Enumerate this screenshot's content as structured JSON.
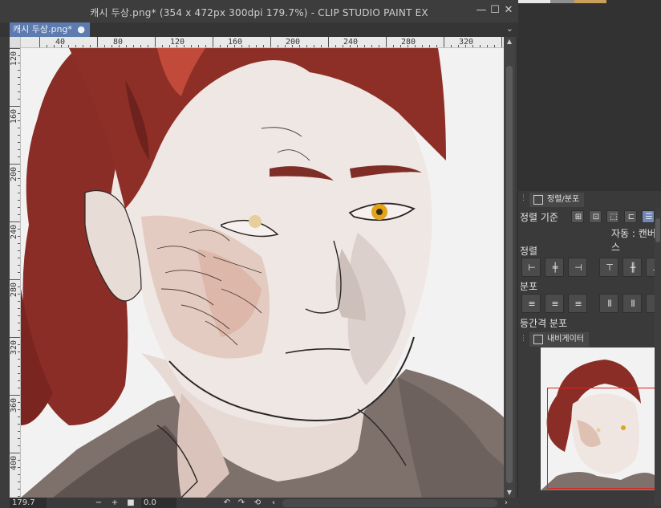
{
  "window": {
    "title": "캐시 두상.png* (354 x 472px 300dpi 179.7%)  - CLIP STUDIO PAINT EX",
    "tab_label": "캐시 두상.png*",
    "tab_dot": "●",
    "minimize": "—",
    "maximize": "☐",
    "close": "✕",
    "chevron": "⌄"
  },
  "ruler": {
    "h_ticks": [
      "40",
      "80",
      "120",
      "160",
      "200",
      "240",
      "280",
      "320"
    ],
    "v_ticks": [
      "120",
      "160",
      "200",
      "240",
      "280",
      "320",
      "360",
      "400"
    ]
  },
  "status": {
    "zoom": "179.7",
    "minus": "−",
    "plus": "+",
    "stop": "■",
    "rotation": "0.0",
    "rot_left": "↶",
    "rot_right": "↷",
    "reset": "⟲",
    "scroll_left": "‹",
    "scroll_right": "›"
  },
  "align_panel": {
    "tab_label": "정렬/분포",
    "criteria_label": "정렬 기준",
    "auto_label": "자동 : 캔버스",
    "align_label": "정렬",
    "distribute_label": "분포",
    "equal_spacing_label": "등간격 분포"
  },
  "navigator": {
    "tab_label": "내비게이터"
  },
  "colors": {
    "accent": "#5e7bb0",
    "hair": "#8c2e26",
    "skin": "#efe6e2",
    "jacket": "#7d706a",
    "view_rect": "#e02020"
  }
}
